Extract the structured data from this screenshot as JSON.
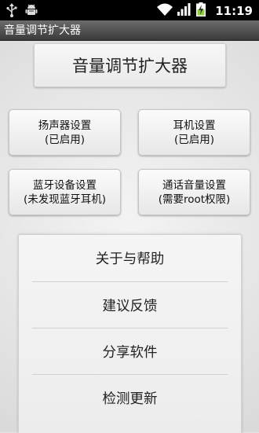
{
  "status_bar": {
    "time": "11:19",
    "icons": [
      "usb-icon",
      "android-debug-icon",
      "wifi-icon",
      "signal-icon",
      "battery-charging-icon"
    ]
  },
  "app": {
    "title": "音量调节扩大器"
  },
  "header": {
    "title": "音量调节扩大器"
  },
  "buttons": {
    "speaker": {
      "label": "扬声器设置",
      "status": "(已启用)"
    },
    "headphone": {
      "label": "耳机设置",
      "status": "(已启用)"
    },
    "bluetooth": {
      "label": "蓝牙设备设置",
      "status": "(未发现蓝牙耳机)"
    },
    "call": {
      "label": "通话音量设置",
      "status": "(需要root权限)"
    }
  },
  "menu": {
    "items": [
      {
        "label": "关于与帮助"
      },
      {
        "label": "建议反馈"
      },
      {
        "label": "分享软件"
      },
      {
        "label": "检测更新"
      }
    ]
  }
}
